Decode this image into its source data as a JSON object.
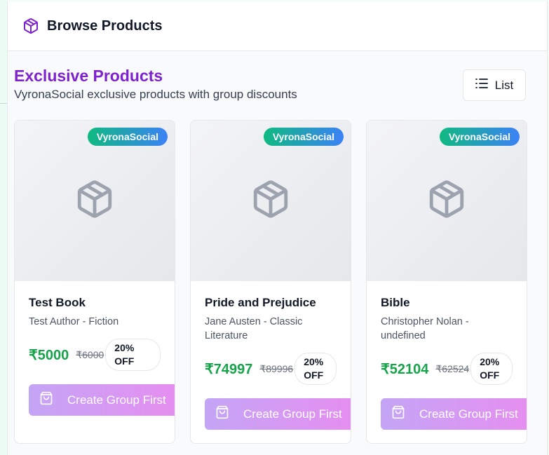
{
  "header": {
    "title": "Browse Products",
    "icon": "package-icon"
  },
  "section": {
    "title": "Exclusive Products",
    "subtitle": "VyronaSocial exclusive products with group discounts"
  },
  "view_toggle": {
    "label": "List",
    "icon": "list-icon"
  },
  "products": [
    {
      "badge": "VyronaSocial",
      "name": "Test Book",
      "meta": "Test Author - Fiction",
      "price": "₹5000",
      "old_price": "₹6000",
      "discount": "20% OFF",
      "cta": "Create Group First"
    },
    {
      "badge": "VyronaSocial",
      "name": "Pride and Prejudice",
      "meta": "Jane Austen - Classic Literature",
      "price": "₹74997",
      "old_price": "₹89996",
      "discount": "20% OFF",
      "cta": "Create Group First"
    },
    {
      "badge": "VyronaSocial",
      "name": "Bible",
      "meta": "Christopher Nolan - undefined",
      "price": "₹52104",
      "old_price": "₹62524",
      "discount": "20% OFF",
      "cta": "Create Group First"
    }
  ],
  "colors": {
    "section_title": "#7e22ce",
    "price": "#16a34a",
    "badge_gradient": [
      "#10b981",
      "#3b82f6"
    ],
    "cta_gradient": [
      "#c4a5f5",
      "#e68ef0"
    ]
  }
}
